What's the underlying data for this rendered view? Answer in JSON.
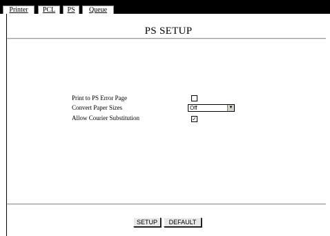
{
  "tabs": [
    {
      "label": "Printer"
    },
    {
      "label": "PCL"
    },
    {
      "label": "PS"
    },
    {
      "label": "Queue"
    }
  ],
  "page": {
    "title": "PS SETUP"
  },
  "settings": {
    "error_page": {
      "label": "Print to PS Error Page",
      "checked": false
    },
    "paper_sizes": {
      "label": "Convert Paper Sizes",
      "value": "Off"
    },
    "courier": {
      "label": "Allow Courier Substitution",
      "checked": true
    }
  },
  "buttons": {
    "setup": "SETUP",
    "default": "DEFAULT"
  }
}
